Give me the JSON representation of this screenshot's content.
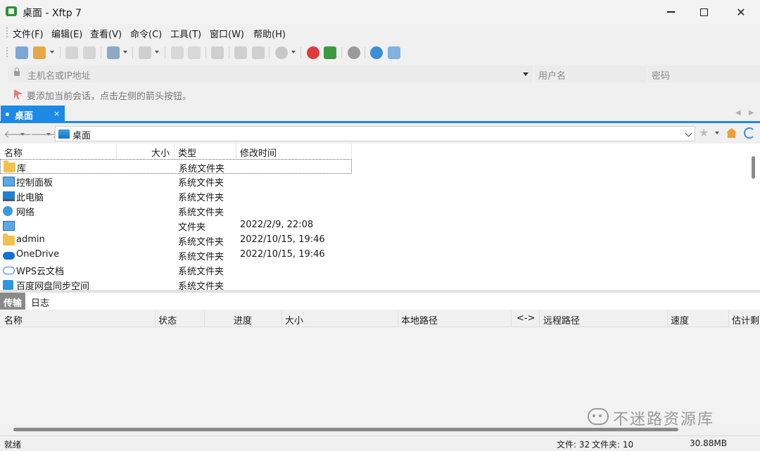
{
  "window": {
    "title": "桌面 - Xftp 7"
  },
  "menu": [
    "文件(F)",
    "编辑(E)",
    "查看(V)",
    "命令(C)",
    "工具(T)",
    "窗口(W)",
    "帮助(H)"
  ],
  "toolbar": {
    "icons": [
      "new-session-icon",
      "open-session-icon",
      "connect-icon",
      "disconnect-icon",
      "sync-icon",
      "terminal-icon",
      "copy-icon",
      "paste-icon",
      "transfer-icon",
      "queue-icon",
      "queue2-icon",
      "record-icon",
      "xshell-icon",
      "xftp-green-icon",
      "settings-icon",
      "help-icon",
      "feedback-icon"
    ]
  },
  "address": {
    "host_placeholder": "主机名或IP地址",
    "user_placeholder": "用户名",
    "pass_placeholder": "密码"
  },
  "hint": "要添加当前会话，点击左侧的箭头按钮。",
  "session_tab": {
    "label": "桌面",
    "close": "×"
  },
  "path": {
    "current": "桌面"
  },
  "file_columns": [
    "名称",
    "大小",
    "类型",
    "修改时间"
  ],
  "files": [
    {
      "name": "库",
      "size": "",
      "type": "系统文件夹",
      "modified": "",
      "icon": "folder-icon"
    },
    {
      "name": "控制面板",
      "size": "",
      "type": "系统文件夹",
      "modified": "",
      "icon": "control-panel-icon"
    },
    {
      "name": "此电脑",
      "size": "",
      "type": "系统文件夹",
      "modified": "",
      "icon": "computer-icon"
    },
    {
      "name": "网络",
      "size": "",
      "type": "系统文件夹",
      "modified": "",
      "icon": "network-icon"
    },
    {
      "name": "",
      "size": "",
      "type": "文件夹",
      "modified": "2022/2/9, 22:08",
      "icon": "control-panel-icon"
    },
    {
      "name": "admin",
      "size": "",
      "type": "系统文件夹",
      "modified": "2022/10/15, 19:46",
      "icon": "folder-icon"
    },
    {
      "name": "OneDrive",
      "size": "",
      "type": "系统文件夹",
      "modified": "2022/10/15, 19:46",
      "icon": "onedrive-icon"
    },
    {
      "name": "WPS云文档",
      "size": "",
      "type": "系统文件夹",
      "modified": "",
      "icon": "wps-cloud-icon"
    },
    {
      "name": "百度网盘同步空间",
      "size": "",
      "type": "系统文件夹",
      "modified": "",
      "icon": "baidu-netdisk-icon"
    }
  ],
  "bottom_tabs": [
    "传输",
    "日志"
  ],
  "transfer_columns": [
    "名称",
    "状态",
    "进度",
    "大小",
    "本地路径",
    "<->",
    "远程路径",
    "速度",
    "估计剩"
  ],
  "status": {
    "left": "就绪",
    "files": "文件: 32",
    "folders": "文件夹: 10",
    "size": "30.88MB"
  },
  "watermark": "不迷路资源库",
  "colors": {
    "accent": "#1e88e5",
    "folder": "#f2c14e"
  }
}
